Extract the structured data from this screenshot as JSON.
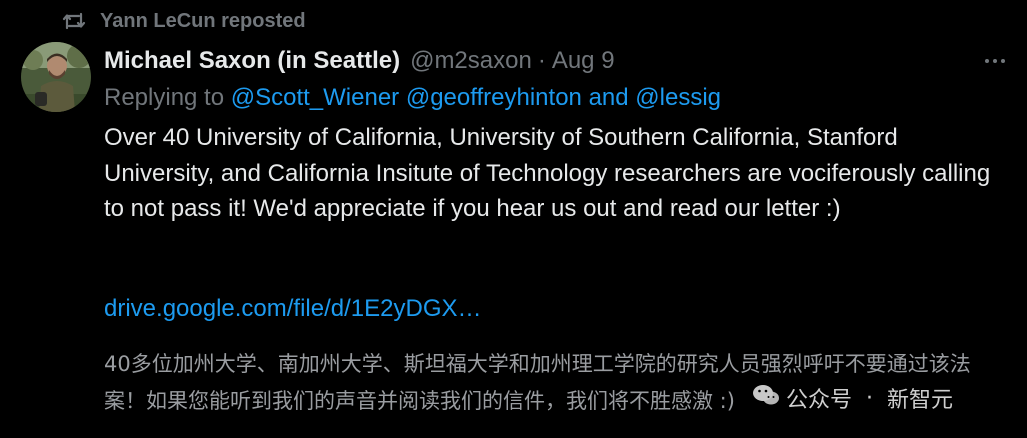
{
  "repost": {
    "icon": "repost-icon",
    "text": "Yann LeCun reposted"
  },
  "tweet": {
    "author_name": "Michael Saxon (in Seattle)",
    "handle": "@m2saxon",
    "separator": "·",
    "date": "Aug 9",
    "more_icon": "more-horizontal-icon",
    "replying_to_prefix": "Replying to",
    "mentions": [
      "@Scott_Wiener",
      "@geoffreyhinton",
      "@lessig"
    ],
    "mention_conjunction": "and",
    "body": "Over 40 University of California, University of Southern California, Stanford University, and California Insitute of Technology researchers are vociferously calling to not pass it! We'd appreciate if you hear us out and read our letter :)",
    "link": "drive.google.com/file/d/1E2yDGX…",
    "translation": "40多位加州大学、南加州大学、斯坦福大学和加州理工学院的研究人员强烈呼吁不要通过该法案！如果您能听到我们的声音并阅读我们的信件，我们将不胜感激 :)"
  },
  "watermark": {
    "icon": "wechat-icon",
    "label": "公众号",
    "dot": "·",
    "name": "新智元"
  },
  "colors": {
    "background": "#000000",
    "text": "#e7e9ea",
    "secondary": "#71767b",
    "accent": "#1d9bf0"
  }
}
